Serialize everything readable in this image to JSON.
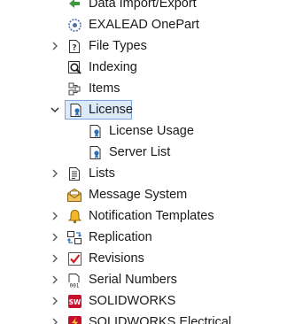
{
  "tree": {
    "items": [
      {
        "label": "Data Import/Export",
        "icon": "import-export-icon",
        "expander": "none"
      },
      {
        "label": "EXALEAD OnePart",
        "icon": "exalead-icon",
        "expander": "none"
      },
      {
        "label": "File Types",
        "icon": "file-types-icon",
        "expander": "collapsed"
      },
      {
        "label": "Indexing",
        "icon": "indexing-icon",
        "expander": "none"
      },
      {
        "label": "Items",
        "icon": "items-icon",
        "expander": "none"
      },
      {
        "label": "License",
        "icon": "license-icon",
        "expander": "expanded",
        "selected": true
      },
      {
        "label": "License Usage",
        "icon": "license-usage-icon",
        "expander": "none"
      },
      {
        "label": "Server List",
        "icon": "server-list-icon",
        "expander": "none"
      },
      {
        "label": "Lists",
        "icon": "lists-icon",
        "expander": "collapsed"
      },
      {
        "label": "Message System",
        "icon": "message-system-icon",
        "expander": "none"
      },
      {
        "label": "Notification Templates",
        "icon": "bell-icon",
        "expander": "collapsed"
      },
      {
        "label": "Replication",
        "icon": "replication-icon",
        "expander": "collapsed"
      },
      {
        "label": "Revisions",
        "icon": "revisions-icon",
        "expander": "collapsed"
      },
      {
        "label": "Serial Numbers",
        "icon": "serial-numbers-icon",
        "expander": "collapsed"
      },
      {
        "label": "SOLIDWORKS",
        "icon": "solidworks-icon",
        "expander": "collapsed"
      },
      {
        "label": "SOLIDWORKS Electrical",
        "icon": "solidworks-electrical-icon",
        "expander": "collapsed"
      }
    ]
  },
  "colors": {
    "selection_bg": "#dcebfc",
    "selection_border": "#7aa7e0",
    "chevron": "#5a5a5a"
  }
}
